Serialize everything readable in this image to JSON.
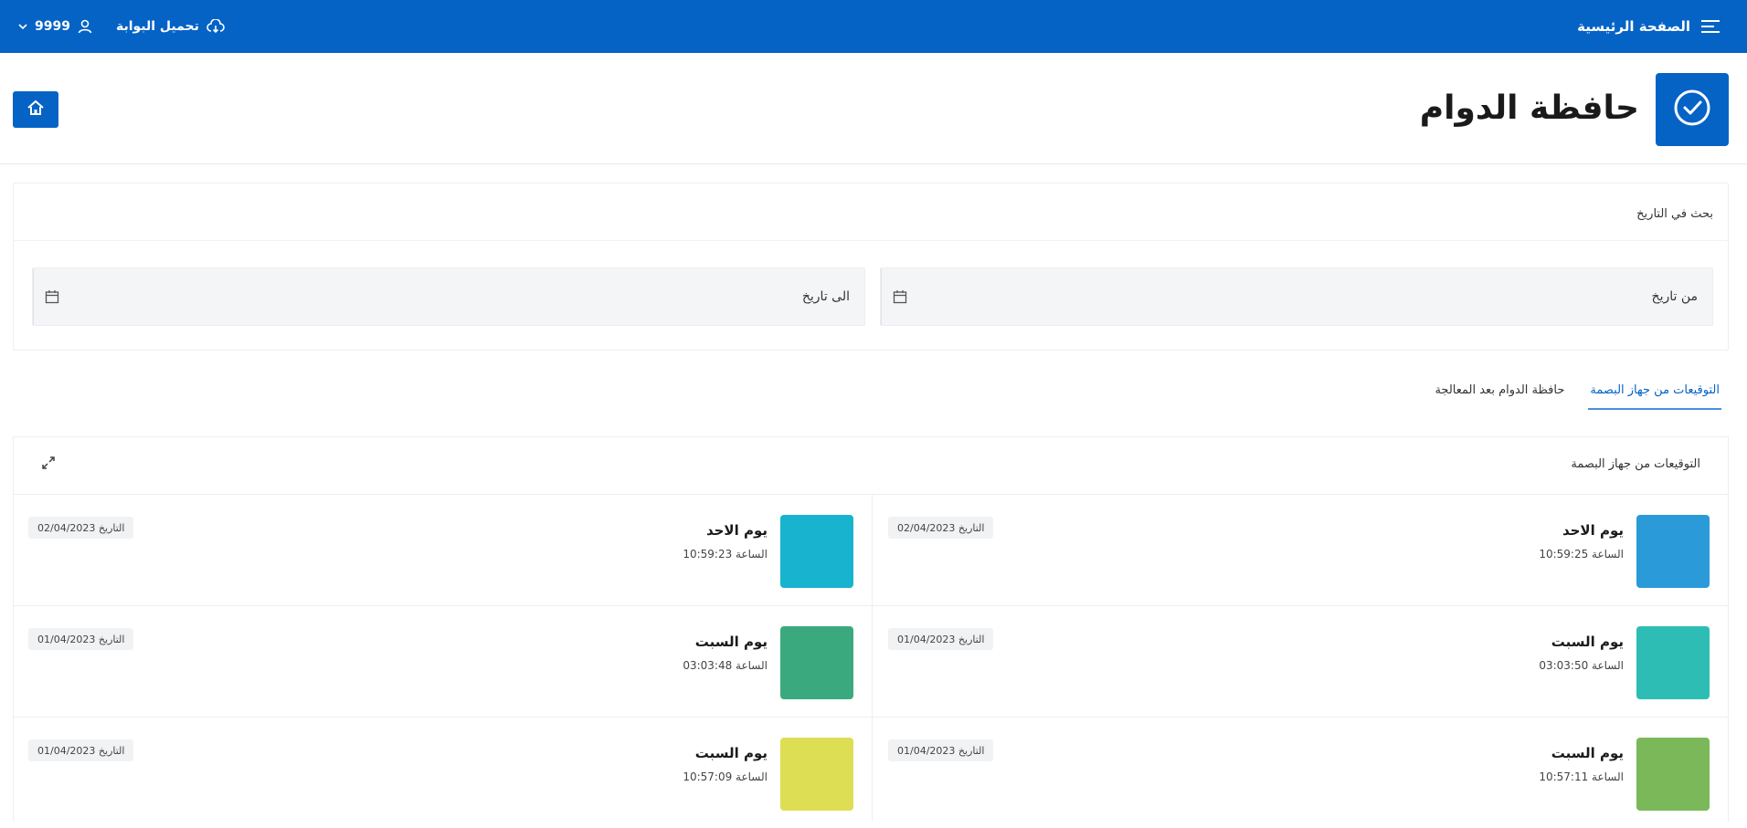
{
  "topbar": {
    "home_label": "الصفحة الرئيسية",
    "portal_label": "تحميل البوابة",
    "user_label": "9999"
  },
  "header": {
    "title": "حافظة الدوام"
  },
  "search": {
    "title": "بحث في التاريخ",
    "from_label": "من تاريخ",
    "to_label": "الى تاريخ"
  },
  "tabs": [
    {
      "label": "التوقيعات من جهاز البصمة",
      "active": true
    },
    {
      "label": "حافظة الدوام بعد المعالجة",
      "active": false
    }
  ],
  "list": {
    "title": "التوقيعات من جهاز البصمة",
    "entries": [
      {
        "day": "يوم الاحد",
        "time_label": "الساعة",
        "time": "10:59:25",
        "date_label": "التاريخ",
        "date": "02/04/2023",
        "color": "#2b9ad9"
      },
      {
        "day": "يوم الاحد",
        "time_label": "الساعة",
        "time": "10:59:23",
        "date_label": "التاريخ",
        "date": "02/04/2023",
        "color": "#17b3cf"
      },
      {
        "day": "يوم السبت",
        "time_label": "الساعة",
        "time": "03:03:50",
        "date_label": "التاريخ",
        "date": "01/04/2023",
        "color": "#2dbdb5"
      },
      {
        "day": "يوم السبت",
        "time_label": "الساعة",
        "time": "03:03:48",
        "date_label": "التاريخ",
        "date": "01/04/2023",
        "color": "#3aaa7e"
      },
      {
        "day": "يوم السبت",
        "time_label": "الساعة",
        "time": "10:57:11",
        "date_label": "التاريخ",
        "date": "01/04/2023",
        "color": "#7ab85a"
      },
      {
        "day": "يوم السبت",
        "time_label": "الساعة",
        "time": "10:57:09",
        "date_label": "التاريخ",
        "date": "01/04/2023",
        "color": "#dede55"
      }
    ]
  },
  "colors": {
    "primary": "#0563c6",
    "tab_underline": "#4a8fe0"
  }
}
